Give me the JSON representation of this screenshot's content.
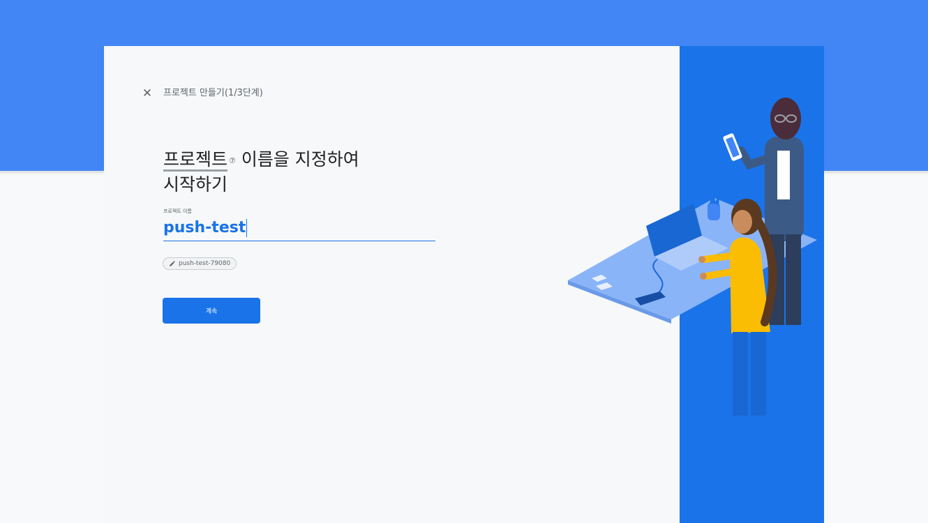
{
  "dialog": {
    "close_icon": "close-icon",
    "close_symbol": "✕",
    "step_label": "프로젝트 만들기(1/3단계)",
    "heading": {
      "word": "프로젝트",
      "help_mark": "⑦",
      "rest_line1": " 이름을 지정하여",
      "line2": "시작하기"
    },
    "project_name": {
      "label": "프로젝트 이름",
      "value": "push-test"
    },
    "project_id_chip": {
      "icon": "pencil-icon",
      "text": "push-test-79080"
    },
    "continue_label": "계속"
  },
  "colors": {
    "brand_blue": "#4285f4",
    "accent_blue": "#1a73e8",
    "panel_blue": "#1a73e8",
    "background": "#f8f9fa",
    "dialog_background": "#f6f8f9"
  }
}
